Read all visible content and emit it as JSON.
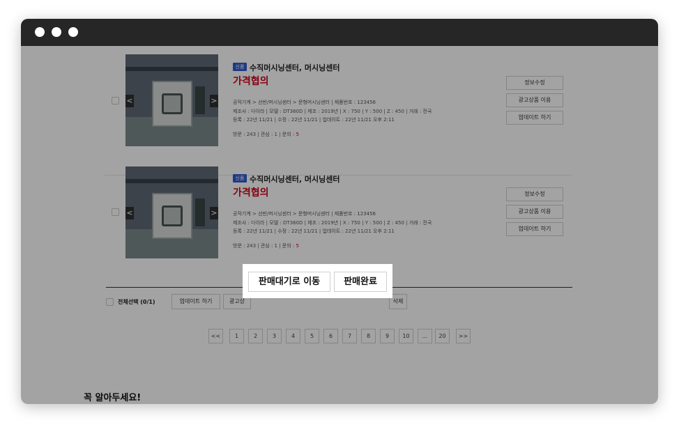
{
  "items": [
    {
      "badge": "신품",
      "title": "수직머시닝센터, 머시닝센터",
      "price": "가격협의",
      "meta1": "공작기계 > 선반/머시닝센터 > 문형머시닝센터 | 제품번호 : 123456",
      "meta2": "제조사 : 다이라 | 모델 : DT360D | 제조 : 2019년 | X : 750 | Y : 500 | Z : 450 | 거래 : 전국",
      "meta3": "등록 : 22년 11/21 | 수정 : 22년 11/21 | 업데이트 : 22년 11/21 오후 2:11",
      "meta4_prefix": "방문 : 243 | 관심 : 1 | 문의 : ",
      "meta4_count": "5",
      "actions": [
        "정보수정",
        "광고상품 이용",
        "업데이트 하기"
      ]
    },
    {
      "badge": "신품",
      "title": "수직머시닝센터, 머시닝센터",
      "price": "가격협의",
      "meta1": "공작기계 > 선반/머시닝센터 > 문형머시닝센터 | 제품번호 : 123456",
      "meta2": "제조사 : 다이라 | 모델 : DT360D | 제조 : 2019년 | X : 750 | Y : 500 | Z : 450 | 거래 : 전국",
      "meta3": "등록 : 22년 11/21 | 수정 : 22년 11/21 | 업데이트 : 22년 11/21 오후 2:11",
      "meta4_prefix": "방문 : 243 | 관심 : 1 | 문의 : ",
      "meta4_count": "5",
      "actions": [
        "정보수정",
        "광고상품 이용",
        "업데이트 하기"
      ]
    }
  ],
  "bulk_bar": {
    "select_all": "전체선택 (0/1)",
    "update": "업데이트 하기",
    "ad": "광고상",
    "delete": "삭제"
  },
  "popup": {
    "move_waiting": "판매대기로 이동",
    "sold_out": "판매완료"
  },
  "pagination": {
    "first": "<<",
    "pages": [
      "1",
      "2",
      "3",
      "4",
      "5",
      "6",
      "7",
      "8",
      "9",
      "10",
      "...",
      "20"
    ],
    "last": ">>"
  },
  "notice": {
    "heading": "꼭 알아두세요!"
  },
  "arrows": {
    "prev": "<",
    "next": ">"
  }
}
